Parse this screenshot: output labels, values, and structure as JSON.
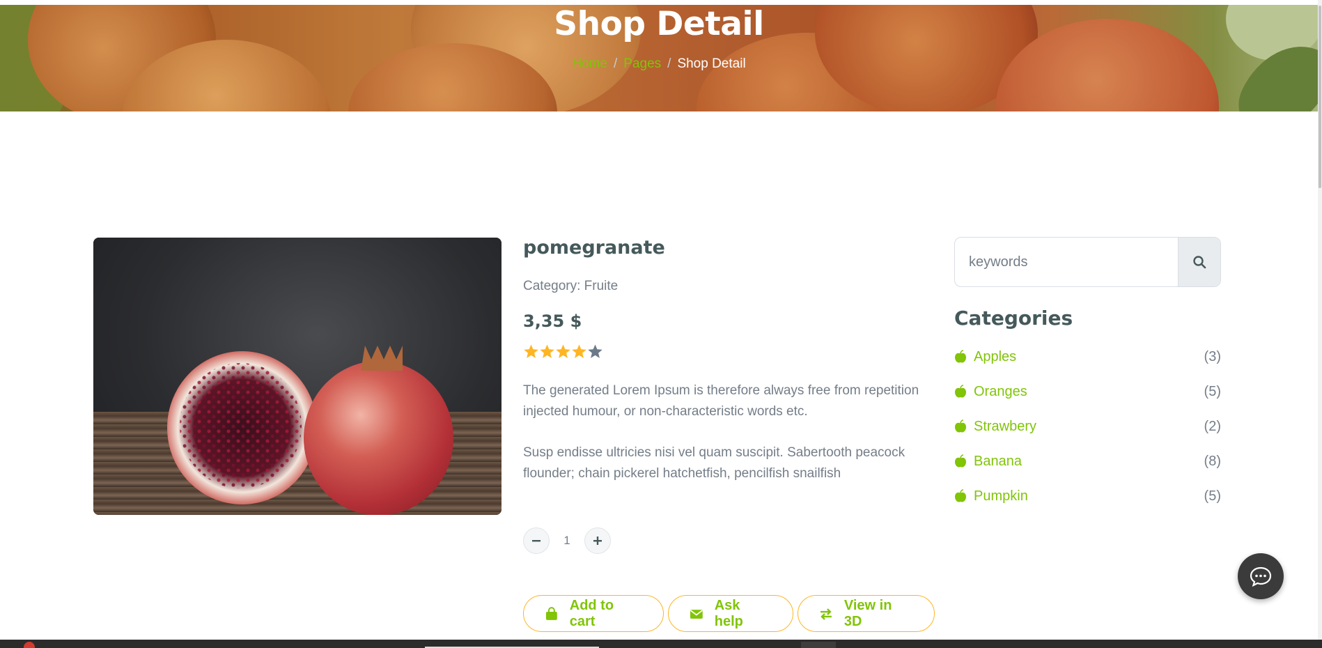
{
  "hero": {
    "title": "Shop Detail",
    "breadcrumb": {
      "home": "Home",
      "separator": "/",
      "pages": "Pages",
      "current": "Shop Detail"
    }
  },
  "product": {
    "name": "pomegranate",
    "category": "Category: Fruite",
    "price": "3,35 $",
    "rating": 4,
    "rating_max": 5,
    "description_1": "The generated Lorem Ipsum is therefore always free from repetition injected humour, or non-characteristic words etc.",
    "description_2": "Susp endisse ultricies nisi vel quam suscipit. Sabertooth peacock flounder; chain pickerel hatchetfish, pencilfish snailfish",
    "quantity": "1"
  },
  "actions": {
    "add_to_cart": "Add to cart",
    "ask_help": "Ask help",
    "view_3d": "View in 3D"
  },
  "sidebar": {
    "search_placeholder": "keywords",
    "categories_title": "Categories",
    "categories": [
      {
        "name": "Apples",
        "count": "(3)"
      },
      {
        "name": "Oranges",
        "count": "(5)"
      },
      {
        "name": "Strawbery",
        "count": "(2)"
      },
      {
        "name": "Banana",
        "count": "(8)"
      },
      {
        "name": "Pumpkin",
        "count": "(5)"
      }
    ]
  },
  "icons": {
    "star": "star-icon",
    "minus": "minus-icon",
    "plus": "plus-icon",
    "cart": "shopping-bag-icon",
    "mail": "envelope-icon",
    "exchange": "exchange-arrows-icon",
    "search": "search-icon",
    "category": "apple-icon",
    "chat": "chat-bubble-icon"
  },
  "colors": {
    "primary_green": "#81c408",
    "accent_yellow": "#ffb524",
    "heading": "#45595b",
    "text": "#747d88",
    "star_off": "#6b7a8a"
  }
}
